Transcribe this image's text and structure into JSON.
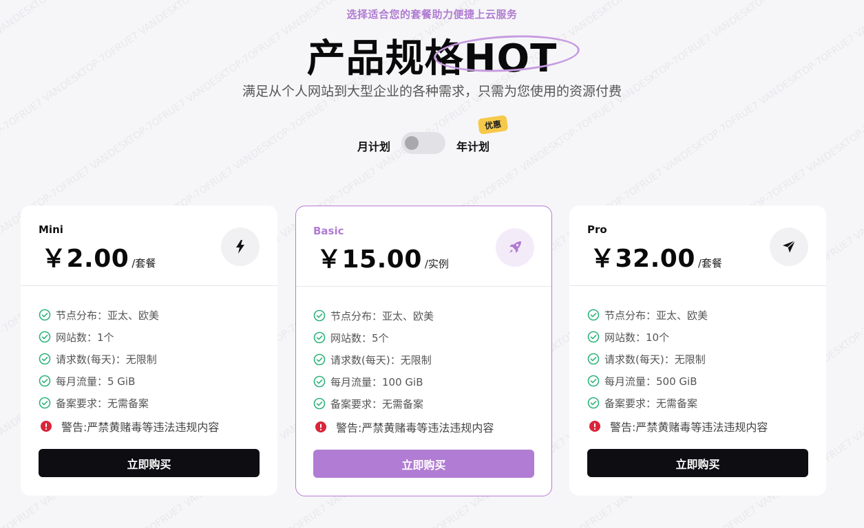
{
  "header": {
    "kicker": "选择适合您的套餐助力便捷上云服务",
    "title": "产品规格HOT",
    "subtitle": "满足从个人网站到大型企业的各种需求，只需为您使用的资源付费"
  },
  "billing_toggle": {
    "monthly_label": "月计划",
    "yearly_label": "年计划",
    "badge": "优惠",
    "selected": "月计划"
  },
  "colors": {
    "accent": "#b07bd2",
    "check_green": "#2fb37a",
    "warn_red": "#d9263a",
    "button_dark": "#0d0d12",
    "badge_yellow": "#f7c94a"
  },
  "plans": [
    {
      "name": "Mini",
      "price": "￥2.00",
      "unit": "/套餐",
      "icon": "lightning-icon",
      "features": [
        "节点分布：亚太、欧美",
        "网站数：1个",
        "请求数(每天)：无限制",
        "每月流量：5 GiB",
        "备案要求：无需备案"
      ],
      "warning": "警告:严禁黄赌毒等违法违规内容",
      "button": "立即购买"
    },
    {
      "name": "Basic",
      "price": "￥15.00",
      "unit": "/实例",
      "icon": "rocket-icon",
      "features": [
        "节点分布：亚太、欧美",
        "网站数：5个",
        "请求数(每天)：无限制",
        "每月流量：100 GiB",
        "备案要求：无需备案"
      ],
      "warning": "警告:严禁黄赌毒等违法违规内容",
      "button": "立即购买"
    },
    {
      "name": "Pro",
      "price": "￥32.00",
      "unit": "/套餐",
      "icon": "paper-plane-icon",
      "features": [
        "节点分布：亚太、欧美",
        "网站数：10个",
        "请求数(每天)：无限制",
        "每月流量：500 GiB",
        "备案要求：无需备案"
      ],
      "warning": "警告:严禁黄赌毒等违法违规内容",
      "button": "立即购买"
    }
  ]
}
